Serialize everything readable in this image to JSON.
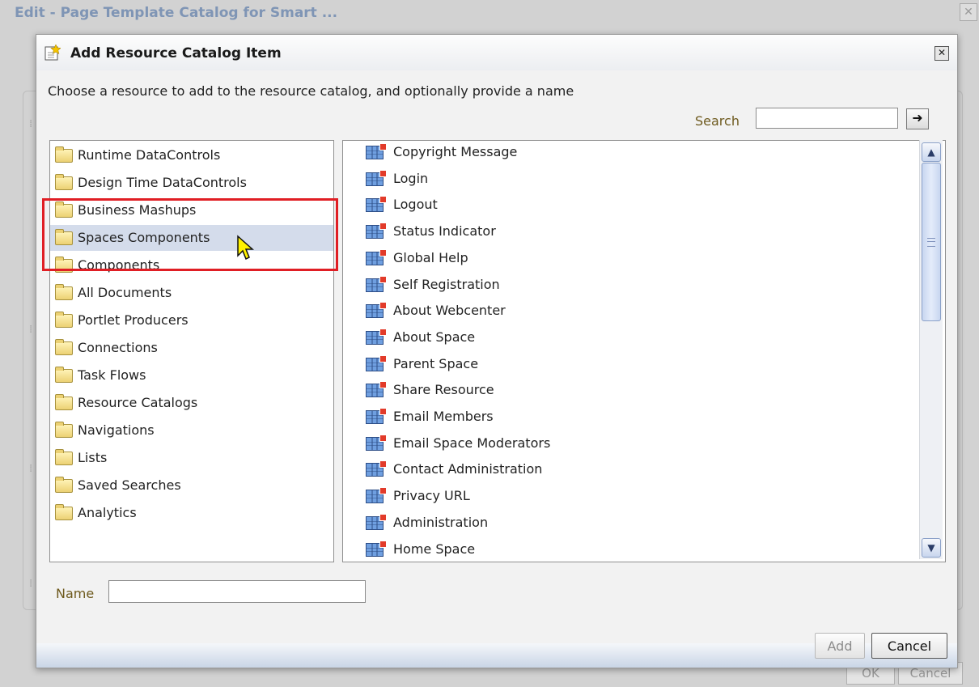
{
  "background_dialog": {
    "title": "Edit - Page Template Catalog for Smart ...",
    "ok_label": "OK",
    "cancel_label": "Cancel"
  },
  "dialog": {
    "title": "Add Resource Catalog Item",
    "instruction": "Choose a resource to add to the resource catalog, and optionally provide a name",
    "search": {
      "label": "Search",
      "value": "",
      "go_icon": "right-arrow-icon"
    },
    "name": {
      "label": "Name",
      "value": ""
    },
    "buttons": {
      "add": "Add",
      "cancel": "Cancel"
    }
  },
  "categories": [
    {
      "label": "Runtime DataControls",
      "icon": "folder-icon"
    },
    {
      "label": "Design Time DataControls",
      "icon": "folder-icon"
    },
    {
      "label": "Business Mashups",
      "icon": "mashup-folder-icon"
    },
    {
      "label": "Spaces Components",
      "icon": "folder-icon",
      "selected": true
    },
    {
      "label": "Components",
      "icon": "components-folder-icon"
    },
    {
      "label": "All Documents",
      "icon": "documents-folder-icon"
    },
    {
      "label": "Portlet Producers",
      "icon": "portlet-producer-icon"
    },
    {
      "label": "Connections",
      "icon": "folder-icon"
    },
    {
      "label": "Task Flows",
      "icon": "taskflow-folder-icon"
    },
    {
      "label": "Resource Catalogs",
      "icon": "folder-icon"
    },
    {
      "label": "Navigations",
      "icon": "navigation-folder-icon"
    },
    {
      "label": "Lists",
      "icon": "list-folder-icon"
    },
    {
      "label": "Saved Searches",
      "icon": "saved-search-icon"
    },
    {
      "label": "Analytics",
      "icon": "analytics-folder-icon"
    }
  ],
  "items": [
    {
      "label": "Copyright Message",
      "icon": "component-icon"
    },
    {
      "label": "Login",
      "icon": "component-icon"
    },
    {
      "label": "Logout",
      "icon": "component-icon"
    },
    {
      "label": "Status Indicator",
      "icon": "component-icon"
    },
    {
      "label": "Global Help",
      "icon": "component-icon"
    },
    {
      "label": "Self Registration",
      "icon": "component-icon"
    },
    {
      "label": "About Webcenter",
      "icon": "component-icon"
    },
    {
      "label": "About Space",
      "icon": "component-icon"
    },
    {
      "label": "Parent Space",
      "icon": "component-icon"
    },
    {
      "label": "Share Resource",
      "icon": "component-icon"
    },
    {
      "label": "Email Members",
      "icon": "component-icon"
    },
    {
      "label": "Email Space Moderators",
      "icon": "component-icon"
    },
    {
      "label": "Contact Administration",
      "icon": "component-icon"
    },
    {
      "label": "Privacy URL",
      "icon": "component-icon"
    },
    {
      "label": "Administration",
      "icon": "component-icon"
    },
    {
      "label": "Home Space",
      "icon": "component-icon"
    }
  ],
  "colors": {
    "selection": "#d4dceb",
    "highlight_box": "#e01e24",
    "label_text": "#6e5a1e"
  }
}
